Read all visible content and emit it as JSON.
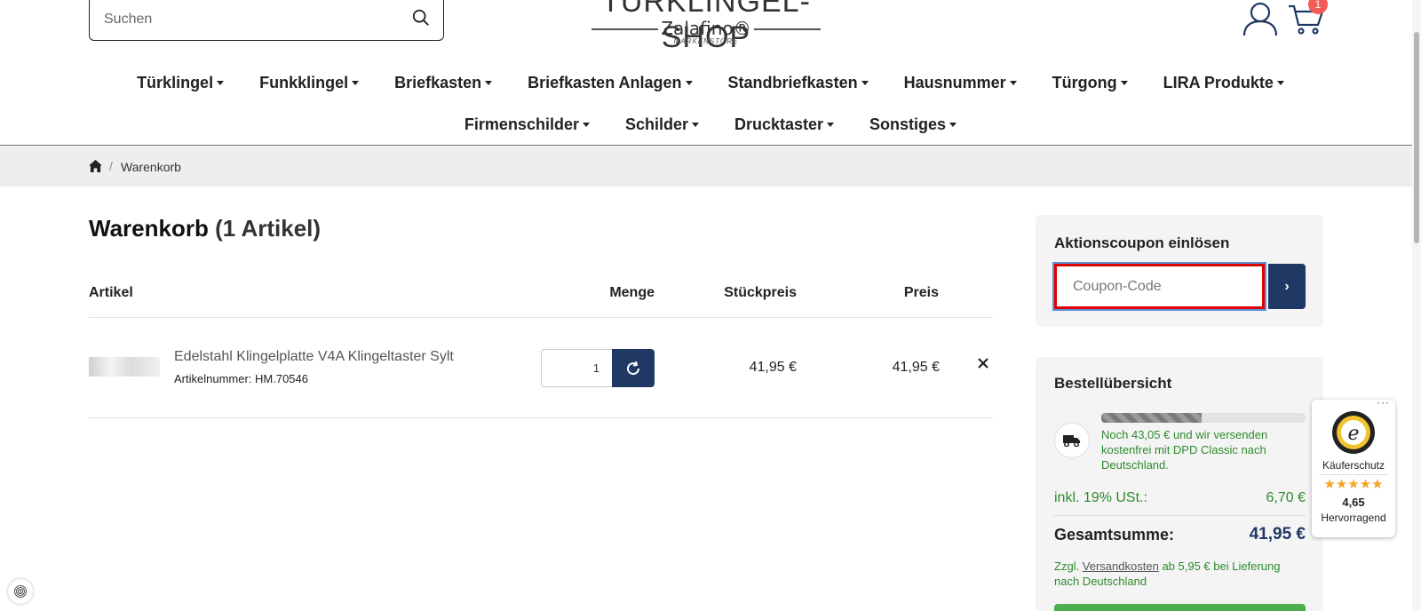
{
  "header": {
    "search_placeholder": "Suchen",
    "logo_main": "TÜRKLINGEL-SHOP",
    "logo_brand": "Zalafino®",
    "logo_store": "MARKENSTORE",
    "cart_count": "1"
  },
  "nav": {
    "row1": [
      "Türklingel",
      "Funkklingel",
      "Briefkasten",
      "Briefkasten Anlagen",
      "Standbriefkasten",
      "Hausnummer",
      "Türgong",
      "LIRA Produkte"
    ],
    "row2": [
      "Firmenschilder",
      "Schilder",
      "Drucktaster",
      "Sonstiges"
    ]
  },
  "breadcrumb": {
    "current": "Warenkorb",
    "separator": "/"
  },
  "cart": {
    "title": "Warenkorb",
    "count_label": "(1 Artikel)",
    "columns": {
      "article": "Artikel",
      "quantity": "Menge",
      "unit_price": "Stückpreis",
      "price": "Preis"
    },
    "items": [
      {
        "name": "Edelstahl Klingelplatte V4A Klingeltaster Sylt",
        "sku": "Artikelnummer: HM.70546",
        "quantity": "1",
        "unit_price": "41,95 €",
        "price": "41,95 €"
      }
    ]
  },
  "coupon": {
    "title": "Aktionscoupon einlösen",
    "placeholder": "Coupon-Code",
    "button": "›"
  },
  "summary": {
    "title": "Bestellübersicht",
    "free_shipping_progress": 0.49,
    "shipping_text": "Noch 43,05 € und wir versenden kostenfrei mit DPD Classic nach Deutschland.",
    "vat_label": "inkl. 19% USt.:",
    "vat_value": "6,70 €",
    "total_label": "Gesamtsumme:",
    "total_value": "41,95 €",
    "note_prefix": "Zzgl.",
    "note_link": "Versandkosten",
    "note_suffix": "ab 5,95 € bei Lieferung nach Deutschland"
  },
  "trusted_shops": {
    "label": "Käuferschutz",
    "stars": "★★★★★",
    "score": "4,65",
    "rating_text": "Hervorragend",
    "seal_letter": "e"
  },
  "colors": {
    "primary": "#1f3864",
    "success_text": "#2d8a2d",
    "badge": "#f25c54",
    "focus_border": "#e00000"
  }
}
